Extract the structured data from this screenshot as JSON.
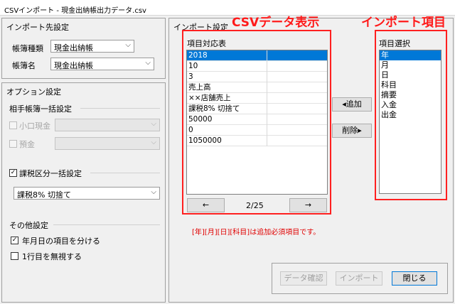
{
  "window": {
    "title": "CSVインポート - 現金出納帳出力データ.csv"
  },
  "import_target": {
    "title": "インポート先設定",
    "book_type_label": "帳簿種類",
    "book_type_value": "現金出納帳",
    "book_name_label": "帳簿名",
    "book_name_value": "現金出納帳"
  },
  "options": {
    "title": "オプション設定",
    "partner_group": {
      "title": "相手帳簿一括設定",
      "petty_cash": {
        "label": "小口現金",
        "checked": false,
        "value": ""
      },
      "deposit": {
        "label": "預金",
        "checked": false,
        "value": ""
      }
    },
    "tax_group": {
      "title": "課税区分一括設定",
      "checked": true,
      "value": "課税8% 切捨て"
    },
    "other": {
      "title": "その他設定",
      "split_date": {
        "label": "年月日の項目を分ける",
        "checked": true
      },
      "ignore_first_row": {
        "label": "1行目を無視する",
        "checked": false
      }
    }
  },
  "import_settings": {
    "title": "インポート設定",
    "csv_annotation": "CSVデータ表示",
    "item_annotation": "インポート項目",
    "mapping_table": {
      "title": "項目対応表",
      "rows": [
        {
          "value": "2018",
          "mapped": "",
          "selected": true
        },
        {
          "value": "10",
          "mapped": ""
        },
        {
          "value": "3",
          "mapped": ""
        },
        {
          "value": "売上高",
          "mapped": ""
        },
        {
          "value": "××店舗売上",
          "mapped": ""
        },
        {
          "value": "課税8% 切捨て",
          "mapped": ""
        },
        {
          "value": "50000",
          "mapped": ""
        },
        {
          "value": "0",
          "mapped": ""
        },
        {
          "value": "1050000",
          "mapped": ""
        }
      ],
      "prev_label": "←",
      "next_label": "→",
      "page_indicator": "2/25"
    },
    "add_button": "◂追加",
    "remove_button": "削除▸",
    "item_select": {
      "title": "項目選択",
      "items": [
        {
          "label": "年",
          "selected": true
        },
        {
          "label": "月"
        },
        {
          "label": "日"
        },
        {
          "label": "科目"
        },
        {
          "label": "摘要"
        },
        {
          "label": "入金"
        },
        {
          "label": "出金"
        }
      ]
    },
    "required_note": "[年][月][日][科目]は追加必須項目です。"
  },
  "footer": {
    "check_button": "データ確認",
    "import_button": "インポート",
    "close_button": "閉じる"
  }
}
